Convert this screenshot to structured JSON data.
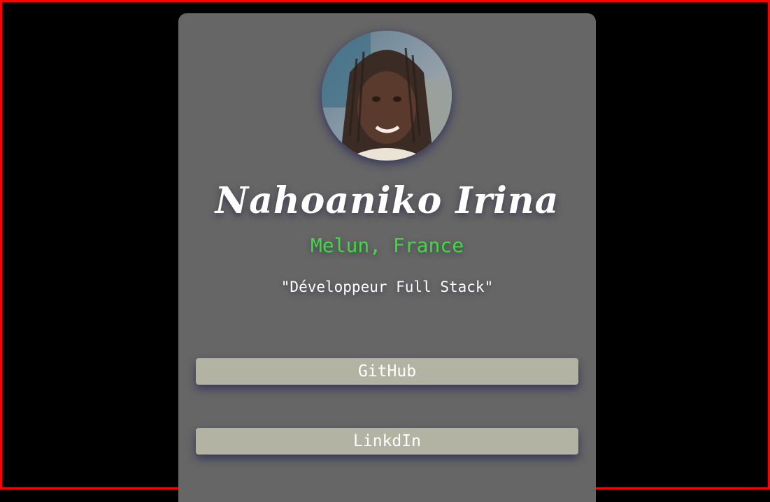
{
  "profile": {
    "avatar_alt": "Profile photo",
    "name": "Nahoaniko Irina",
    "location": "Melun, France",
    "tagline": "\"Développeur Full Stack\""
  },
  "links": {
    "github_label": "GitHub",
    "linkedin_label": "LinkdIn"
  },
  "colors": {
    "card_background": "#666666",
    "location_text": "#3ddb3d",
    "button_background": "#b3b3a3",
    "frame_border": "#ff0000"
  }
}
